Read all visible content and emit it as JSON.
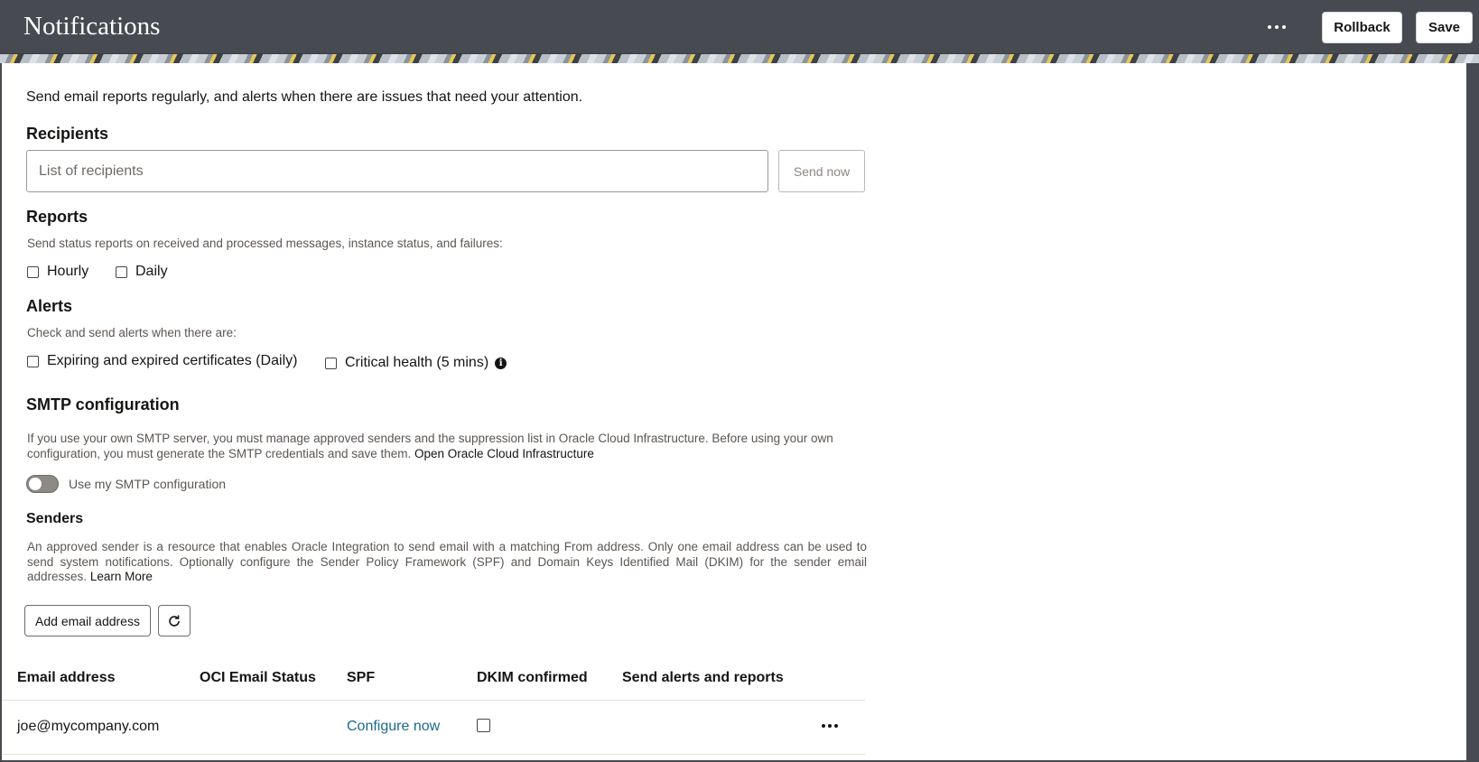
{
  "header": {
    "title": "Notifications",
    "rollback_label": "Rollback",
    "save_label": "Save"
  },
  "intro": "Send email reports regularly, and alerts when there are issues that need your attention.",
  "recipients": {
    "heading": "Recipients",
    "placeholder": "List of recipients",
    "value": "",
    "send_now_label": "Send now"
  },
  "reports": {
    "heading": "Reports",
    "description": "Send status reports on received and processed messages, instance status, and failures:",
    "options": [
      {
        "label": "Hourly",
        "checked": false
      },
      {
        "label": "Daily",
        "checked": false
      }
    ]
  },
  "alerts": {
    "heading": "Alerts",
    "description": "Check and send alerts when there are:",
    "options": [
      {
        "label": "Expiring and expired certificates (Daily)",
        "checked": false
      },
      {
        "label": "Critical health (5 mins)",
        "checked": false
      }
    ]
  },
  "smtp": {
    "heading": "SMTP configuration",
    "description": "If you use your own SMTP server, you must manage approved senders and the suppression list in Oracle Cloud Infrastructure. Before using your own configuration, you must generate the SMTP credentials and save them.",
    "link_label": "Open Oracle Cloud Infrastructure",
    "toggle_label": "Use my SMTP configuration",
    "toggle_on": false
  },
  "senders": {
    "heading": "Senders",
    "description": "An approved sender is a resource that enables Oracle Integration to send email with a matching From address. Only one email address can be used to send system notifications. Optionally configure the Sender Policy Framework (SPF) and Domain Keys Identified Mail (DKIM) for the sender email addresses.",
    "learn_more_label": "Learn More",
    "add_email_label": "Add email address"
  },
  "table": {
    "columns": [
      "Email address",
      "OCI Email Status",
      "SPF",
      "DKIM confirmed",
      "Send alerts and reports"
    ],
    "rows": [
      {
        "email": "joe@mycompany.com",
        "oci_status": "",
        "spf": "Configure now",
        "dkim_confirmed": false,
        "send_alerts": ""
      }
    ]
  },
  "colors": {
    "header_bg": "#474b51",
    "link": "#1b6a8c",
    "text": "#161513",
    "muted": "#5b5652"
  },
  "icons": [
    "more-icon",
    "info-icon",
    "refresh-icon",
    "row-more-icon"
  ]
}
